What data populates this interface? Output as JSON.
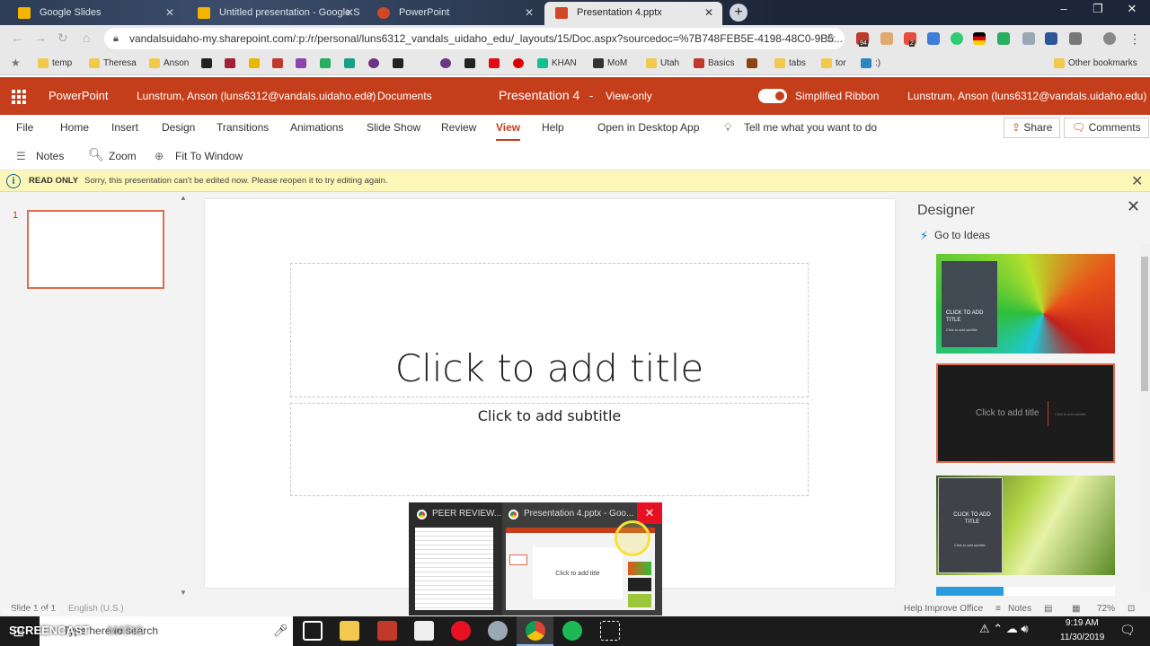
{
  "browser": {
    "tabs": [
      {
        "title": "Google Slides",
        "fav_color": "#f4b400"
      },
      {
        "title": "Untitled presentation - Google S",
        "fav_color": "#f4b400"
      },
      {
        "title": "PowerPoint",
        "fav_color": "#d24726"
      },
      {
        "title": "Presentation 4.pptx",
        "fav_color": "#d24726",
        "active": true
      }
    ],
    "url": "vandalsuidaho-my.sharepoint.com/:p:/r/personal/luns6312_vandals_uidaho_edu/_layouts/15/Doc.aspx?sourcedoc=%7B748FEB5E-4198-48C0-9B5...",
    "bookmarks": [
      "temp",
      "Theresa",
      "Anson",
      "KHAN",
      "MoM",
      "Utah",
      "Basics",
      "tabs",
      "tor",
      ":)"
    ],
    "other_bookmarks": "Other bookmarks",
    "badge_94": "94",
    "badge_2": "2"
  },
  "app": {
    "name": "PowerPoint",
    "breadcrumb_user": "Lunstrum, Anson (luns6312@vandals.uidaho.edu)",
    "breadcrumb_sep": ">",
    "breadcrumb_folder": "Documents",
    "doc_title": "Presentation 4",
    "dash": "-",
    "mode": "View-only",
    "simplified_ribbon": "Simplified Ribbon",
    "user": "Lunstrum, Anson (luns6312@vandals.uidaho.edu)"
  },
  "menu": {
    "file": "File",
    "home": "Home",
    "insert": "Insert",
    "design": "Design",
    "transitions": "Transitions",
    "animations": "Animations",
    "slideshow": "Slide Show",
    "review": "Review",
    "view": "View",
    "help": "Help",
    "open_desktop": "Open in Desktop App",
    "tell_me": "Tell me what you want to do",
    "share": "Share",
    "comments": "Comments"
  },
  "toolbar": {
    "notes": "Notes",
    "zoom": "Zoom",
    "fit": "Fit To Window"
  },
  "readonly": {
    "label": "READ ONLY",
    "message": "Sorry, this presentation can't be edited now. Please reopen it to try editing again."
  },
  "thumbs": {
    "number": "1"
  },
  "slide": {
    "title": "Click to add title",
    "subtitle": "Click to add subtitle"
  },
  "designer": {
    "title": "Designer",
    "go_to_ideas": "Go to Ideas",
    "card1_title": "CLICK TO ADD TITLE",
    "card1_sub": "Click to add subtitle",
    "card2_title": "Click to add title",
    "card2_sub": "Click to add subtitle",
    "card3_title": "CLICK TO ADD TITLE",
    "card3_sub": "Click to add subtitle"
  },
  "status": {
    "slide_of": "Slide 1 of 1",
    "language": "English (U.S.)",
    "help_improve": "Help Improve Office",
    "notes": "Notes",
    "zoom": "72%"
  },
  "taskbar": {
    "search": "Type here to search",
    "time": "9:19 AM",
    "date": "11/30/2019",
    "watermark_top": "RECORDED WITH",
    "watermark_brand": "SCREENCAST",
    "watermark_tail": "MATIC"
  },
  "preview": {
    "item1": "PEER REVIEW...",
    "item2": "Presentation 4.pptx - Goo...",
    "mini_title": "Click to add title"
  }
}
